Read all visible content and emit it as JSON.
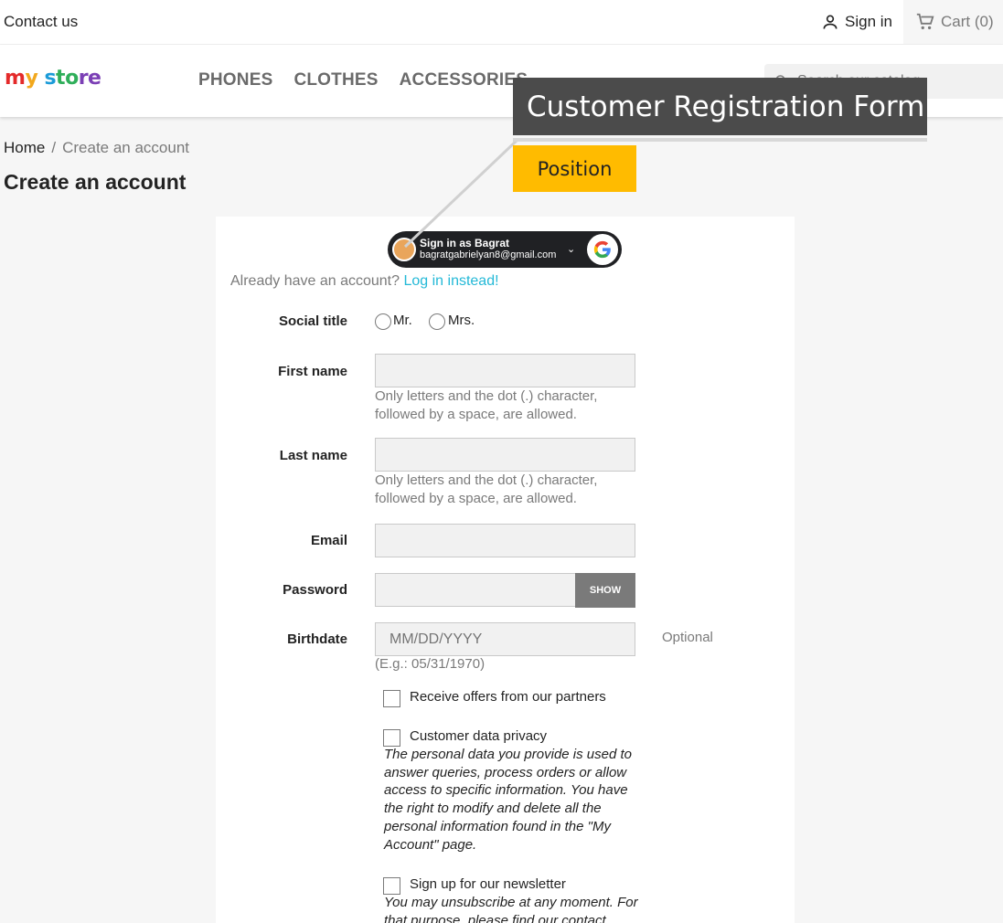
{
  "topbar": {
    "contact": "Contact us",
    "signin": "Sign in",
    "cart": "Cart (0)"
  },
  "header": {
    "logo": [
      "m",
      "y",
      " s",
      "to",
      "re"
    ],
    "nav": [
      "PHONES",
      "CLOTHES",
      "ACCESSORIES"
    ],
    "search_placeholder": "Search our catalog"
  },
  "breadcrumb": {
    "home": "Home",
    "sep": "/",
    "current": "Create an account"
  },
  "page_title": "Create an account",
  "annotation": {
    "title": "Customer Registration Form",
    "tag": "Position"
  },
  "google": {
    "name": "Sign in as Bagrat",
    "email": "bagratgabrielyan8@gmail.com",
    "chevron": "⌄"
  },
  "form": {
    "already": "Already have an account?",
    "login_link": "Log in instead!",
    "social_title_label": "Social title",
    "mr": "Mr.",
    "mrs": "Mrs.",
    "first_name_label": "First name",
    "first_name_hint": "Only letters and the dot (.) character, followed by a space, are allowed.",
    "last_name_label": "Last name",
    "last_name_hint": "Only letters and the dot (.) character, followed by a space, are allowed.",
    "email_label": "Email",
    "password_label": "Password",
    "show": "SHOW",
    "birthdate_label": "Birthdate",
    "birthdate_placeholder": "MM/DD/YYYY",
    "birthdate_hint": "(E.g.: 05/31/1970)",
    "optional": "Optional",
    "offers": "Receive offers from our partners",
    "privacy": "Customer data privacy",
    "privacy_text": "The personal data you provide is used to answer queries, process orders or allow access to specific information. You have the right to modify and delete all the personal information found in the \"My Account\" page.",
    "newsletter": "Sign up for our newsletter",
    "newsletter_text": "You may unsubscribe at any moment. For that purpose, please find our contact"
  }
}
